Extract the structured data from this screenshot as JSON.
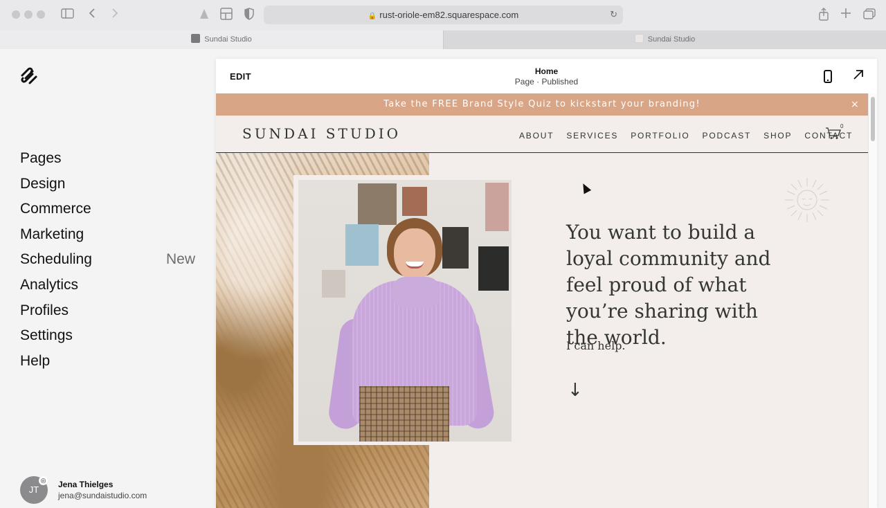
{
  "browser": {
    "url": "rust-oriole-em82.squarespace.com",
    "tabs": [
      {
        "title": "Sundai Studio",
        "active": true
      },
      {
        "title": "Sundai Studio",
        "active": false
      }
    ]
  },
  "sidebar": {
    "items": [
      {
        "label": "Pages"
      },
      {
        "label": "Design"
      },
      {
        "label": "Commerce"
      },
      {
        "label": "Marketing"
      },
      {
        "label": "Scheduling",
        "badge": "New"
      },
      {
        "label": "Analytics"
      },
      {
        "label": "Profiles"
      },
      {
        "label": "Settings"
      },
      {
        "label": "Help"
      }
    ],
    "user": {
      "initials": "JT",
      "name": "Jena Thielges",
      "email": "jena@sundaistudio.com"
    }
  },
  "editor": {
    "edit_label": "EDIT",
    "page_title": "Home",
    "page_status": "Page · Published"
  },
  "site": {
    "announcement": "Take the FREE Brand Style Quiz to kickstart your branding!",
    "announcement_close": "×",
    "brand": "SUNDAI STUDIO",
    "nav": [
      "ABOUT",
      "SERVICES",
      "PORTFOLIO",
      "PODCAST",
      "SHOP",
      "CONTACT"
    ],
    "cart_count": "0",
    "headline": "You want to build a loyal community and feel proud of what you’re sharing with the world.",
    "subline": "I can help.",
    "scroll_arrow": "↓"
  },
  "colors": {
    "announcement_bg": "#d8a586",
    "site_bg": "#f3eeec",
    "text_dark": "#343632"
  }
}
